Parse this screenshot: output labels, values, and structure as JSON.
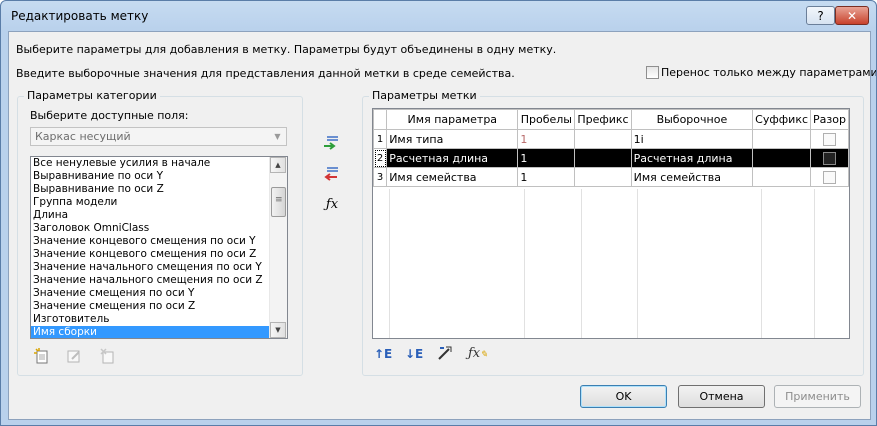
{
  "window": {
    "title": "Редактировать метку",
    "help_label": "?",
    "close_label": "✕"
  },
  "intro": {
    "line1": "Выберите параметры для добавления в метку.  Параметры будут объединены в одну метку.",
    "line2": "Введите выборочные значения для представления данной метки в среде семейства.",
    "only_between_params": "Перенос только между параметрами"
  },
  "category_params": {
    "group_label": "Параметры категории",
    "fields_label": "Выберите доступные поля:",
    "category_value": "Каркас несущий",
    "fields": [
      "Все ненулевые усилия в начале",
      "Выравнивание по оси Y",
      "Выравнивание по оси Z",
      "Группа модели",
      "Длина",
      "Заголовок OmniClass",
      "Значение концевого смещения по оси Y",
      "Значение концевого смещения по оси Z",
      "Значение начального смещения по оси Y",
      "Значение начального смещения по оси Z",
      "Значение смещения по оси Y",
      "Значение смещения по оси Z",
      "Изготовитель",
      "Имя сборки"
    ],
    "selected_field": "Имя сборки"
  },
  "label_params": {
    "group_label": "Параметры метки",
    "columns": [
      "Имя параметра",
      "Пробелы",
      "Префикс",
      "Выборочное",
      "Суффикс",
      "Разор"
    ],
    "rows": [
      {
        "num": "1",
        "name": "Имя типа",
        "spaces": "1",
        "prefix": "",
        "sample": "1i",
        "suffix": "",
        "checked": false
      },
      {
        "num": "2",
        "name": "Расчетная длина",
        "spaces": "1",
        "prefix": "",
        "sample": "Расчетная длина",
        "suffix": "",
        "checked": false
      },
      {
        "num": "3",
        "name": "Имя семейства",
        "spaces": "1",
        "prefix": "",
        "sample": "Имя семейства",
        "suffix": "",
        "checked": false
      }
    ],
    "selected_row": 2
  },
  "icons": {
    "add": "add-arrow-icon",
    "remove": "remove-arrow-icon",
    "formula": "fx-icon",
    "move_up": "move-up-icon",
    "move_down": "move-down-icon",
    "edit_format": "format-icon",
    "edit_formula": "fx-edit-icon",
    "new_param": "new-parameter-icon",
    "edit_param": "edit-parameter-icon",
    "delete_param": "delete-parameter-icon"
  },
  "buttons": {
    "ok": "OK",
    "cancel": "Отмена",
    "apply": "Применить"
  },
  "colors": {
    "selection": "#3399ff",
    "title_gradient": "#c6dbf1",
    "grid_selection": "#000000"
  }
}
